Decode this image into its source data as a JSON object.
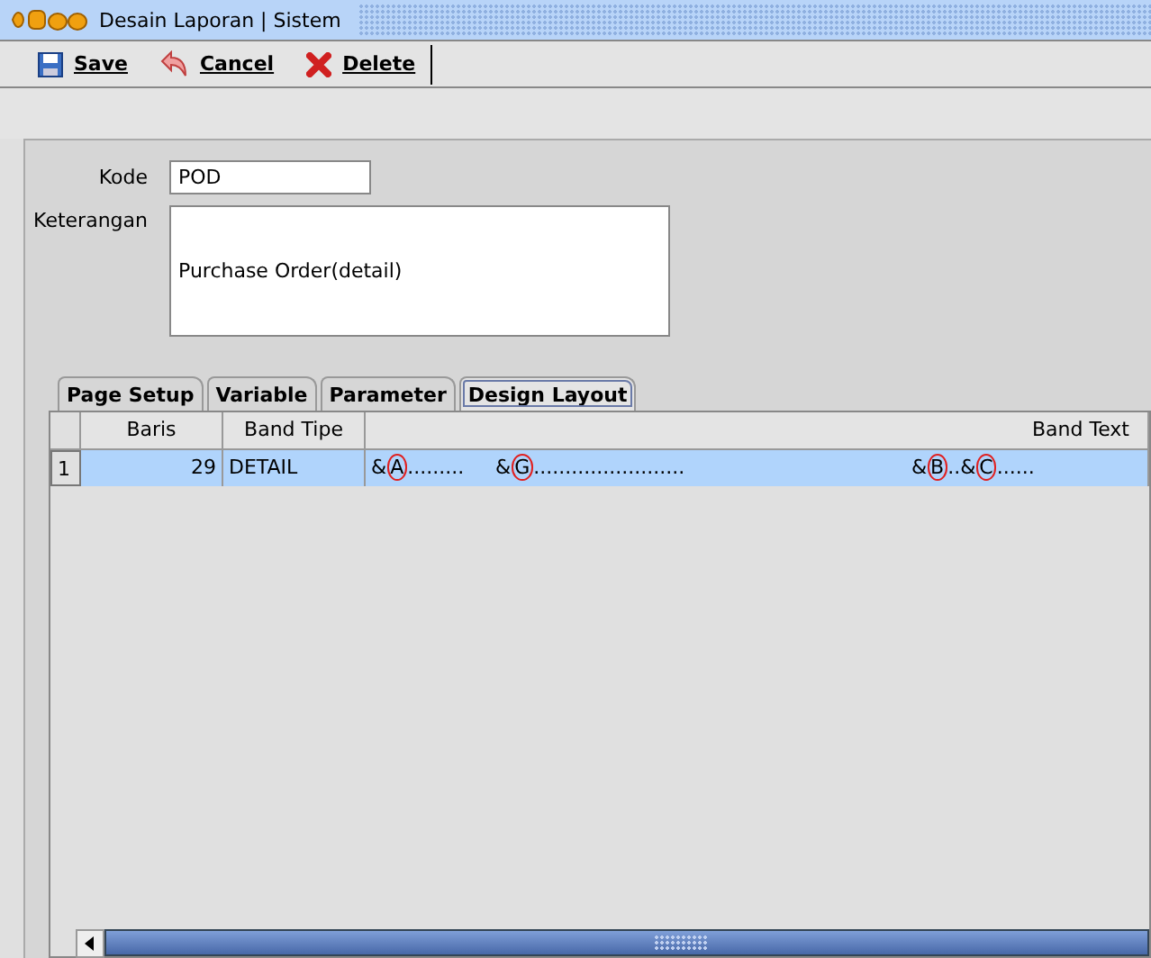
{
  "window": {
    "title": "Desain Laporan | Sistem"
  },
  "toolbar": [
    {
      "label": "Save",
      "kind": "save"
    },
    {
      "label": "Cancel",
      "kind": "cancel"
    },
    {
      "label": "Delete",
      "kind": "delete"
    }
  ],
  "form": {
    "kode": {
      "label": "Kode",
      "value": "POD"
    },
    "keterangan": {
      "label": "Keterangan",
      "value": "Purchase Order(detail)"
    }
  },
  "tabs": [
    {
      "label": "Page Setup",
      "selected": false
    },
    {
      "label": "Variable",
      "selected": false
    },
    {
      "label": "Parameter",
      "selected": false
    },
    {
      "label": "Design Layout",
      "selected": true
    }
  ],
  "table": {
    "columns": [
      "Baris",
      "Band Tipe",
      "Band Text"
    ],
    "rows": [
      {
        "number": "1",
        "baris": "29",
        "band_tipe": "DETAIL",
        "selected": true,
        "band_text": [
          {
            "text": "&"
          },
          {
            "text": "A",
            "circled": true
          },
          {
            "text": ".........     &"
          },
          {
            "text": "G",
            "circled": true
          },
          {
            "text": "........................                                    &"
          },
          {
            "text": "B",
            "circled": true
          },
          {
            "text": "..&"
          },
          {
            "text": "C",
            "circled": true
          },
          {
            "text": "......"
          }
        ]
      }
    ]
  }
}
